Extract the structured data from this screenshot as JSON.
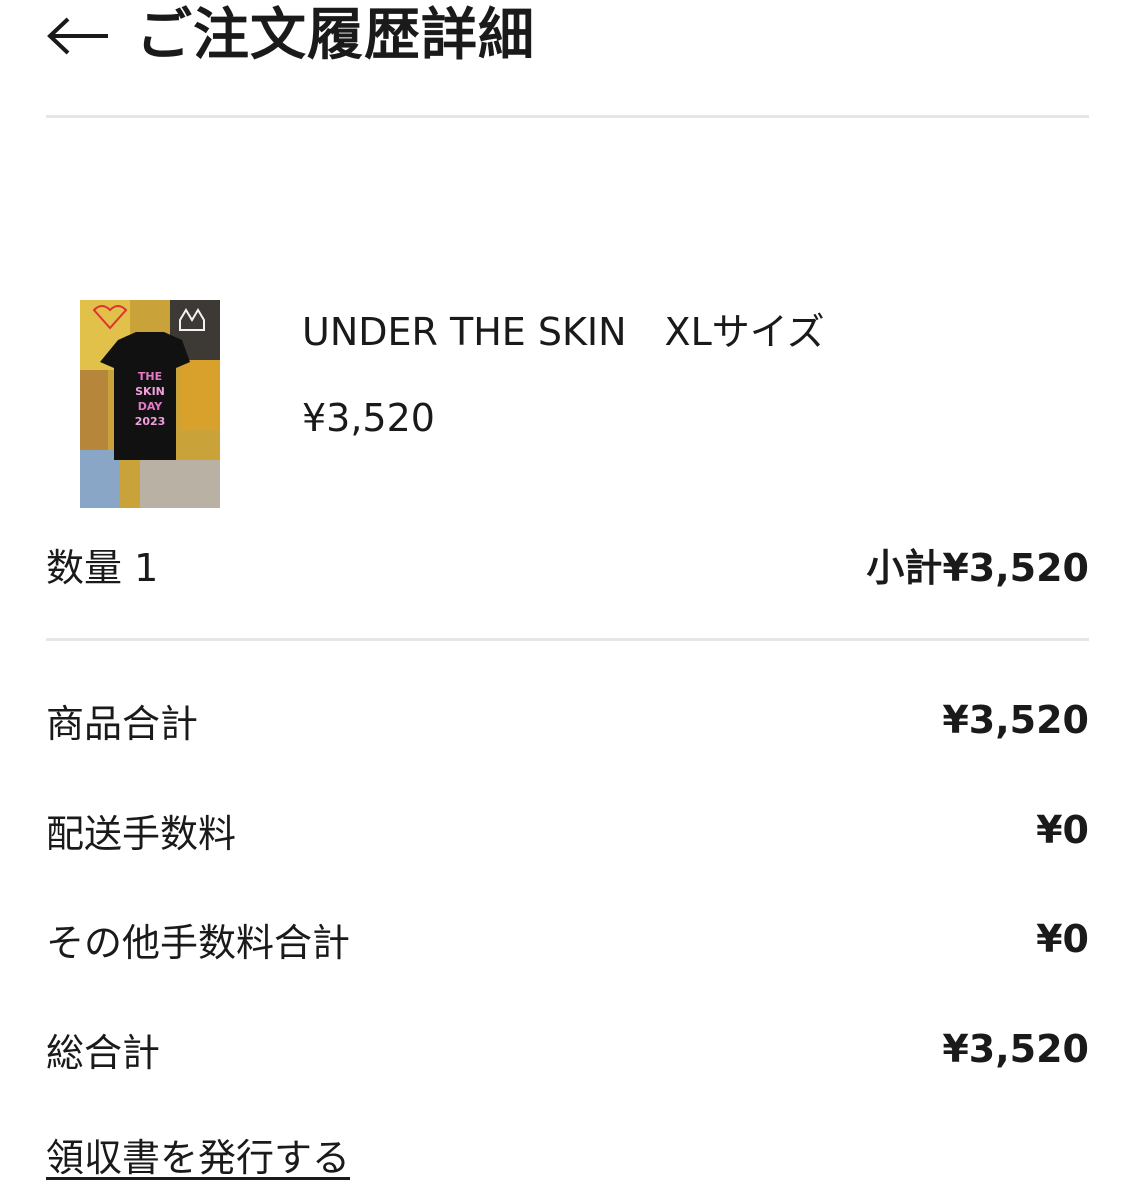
{
  "header": {
    "back_icon": "left-arrow-icon",
    "title": "ご注文履歴詳細"
  },
  "item": {
    "image_icon": "product-photo-tshirt",
    "name": "UNDER THE SKIN　XLサイズ",
    "price": "¥3,520",
    "quantity_label": "数量 1",
    "subtotal_label": "小計¥3,520"
  },
  "summary": {
    "product_total_label": "商品合計",
    "product_total_value": "¥3,520",
    "shipping_label": "配送手数料",
    "shipping_value": "¥0",
    "other_fees_label": "その他手数料合計",
    "other_fees_value": "¥0",
    "grand_total_label": "総合計",
    "grand_total_value": "¥3,520"
  },
  "actions": {
    "receipt_link": "領収書を発行する"
  }
}
